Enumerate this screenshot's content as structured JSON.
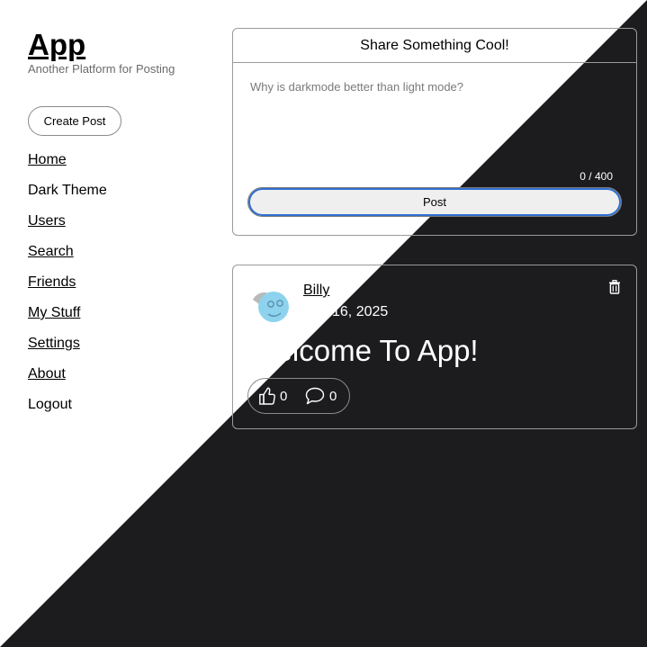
{
  "brand": {
    "title": "App",
    "subtitle": "Another Platform for Posting"
  },
  "sidebar": {
    "create_label": "Create Post",
    "items": [
      {
        "label": "Home"
      },
      {
        "label": "Dark Theme"
      },
      {
        "label": "Users"
      },
      {
        "label": "Search"
      },
      {
        "label": "Friends"
      },
      {
        "label": "My Stuff"
      },
      {
        "label": "Settings"
      },
      {
        "label": "About"
      },
      {
        "label": "Logout"
      }
    ]
  },
  "composer": {
    "header": "Share Something Cool!",
    "placeholder": "Why is darkmode better than light mode?",
    "char_count": "0 / 400",
    "post_label": "Post"
  },
  "post": {
    "author": "Billy",
    "date": "Mar 16, 2025",
    "title": "Welcome To App!",
    "likes": "0",
    "comments": "0"
  },
  "colors": {
    "dark_bg": "#1c1c1e",
    "light_bg": "#ffffff",
    "focus_ring": "#2f6fd0",
    "avatar_blue": "#8ed3ee"
  },
  "icons": [
    "shield-icon",
    "trash-icon",
    "thumbs-up-icon",
    "comment-icon",
    "avatar-image"
  ]
}
